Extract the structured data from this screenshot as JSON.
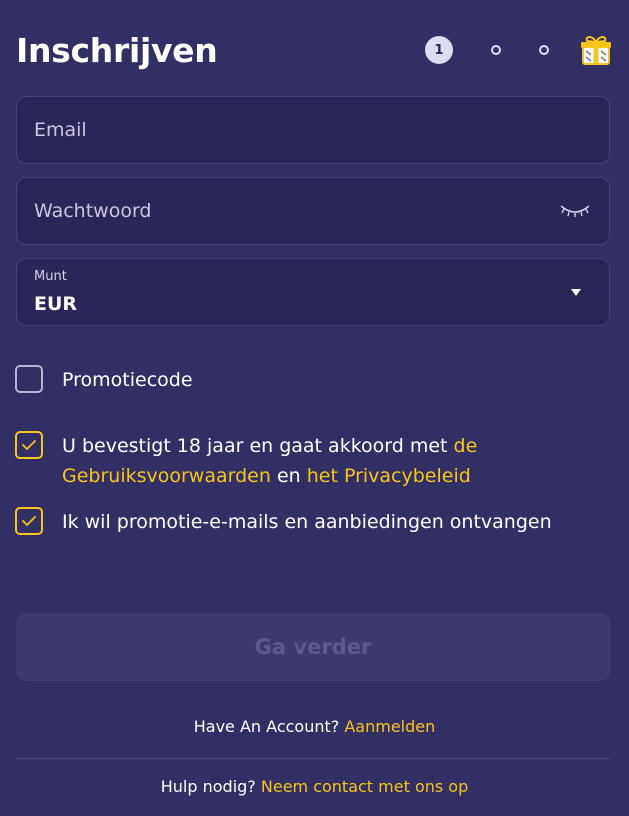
{
  "header": {
    "title": "Inschrijven",
    "steps": [
      "1"
    ]
  },
  "form": {
    "email_placeholder": "Email",
    "password_placeholder": "Wachtwoord",
    "currency_label": "Munt",
    "currency_value": "EUR"
  },
  "promo": {
    "label": "Promotiecode",
    "checked": false
  },
  "terms": {
    "text_1": "U bevestigt 18 jaar en gaat akkoord met ",
    "link_terms": "de Gebruiksvoorwaarden",
    "text_2": " en ",
    "link_privacy": "het Privacybeleid",
    "checked": true
  },
  "marketing": {
    "label": "Ik wil promotie-e-mails en aanbiedingen ontvangen",
    "checked": true
  },
  "submit_label": "Ga verder",
  "footer": {
    "account_text": "Have An Account? ",
    "login_link": "Aanmelden",
    "help_text": "Hulp nodig? ",
    "contact_link": "Neem contact met ons op"
  },
  "colors": {
    "background": "#322f64",
    "field": "#2a2657",
    "accent": "#f7c61b",
    "button_disabled": "#3c3a6e"
  },
  "icons": [
    "eye-closed-icon",
    "gift-icon",
    "check-icon",
    "caret-down-icon"
  ]
}
